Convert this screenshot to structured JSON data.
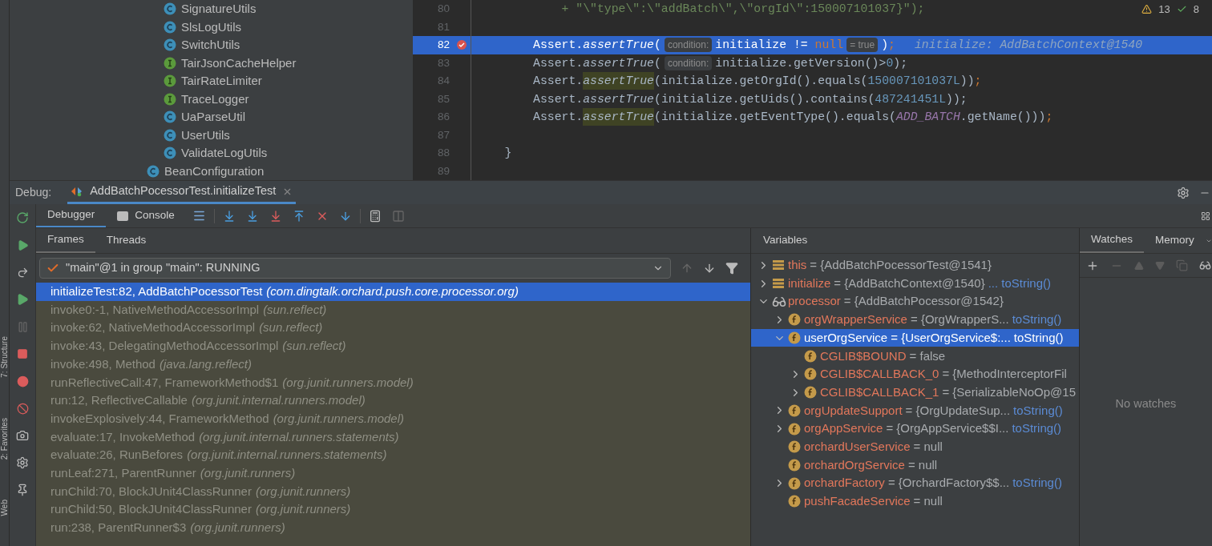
{
  "side_stripe": {
    "labels": [
      "7: Structure",
      "2: Favorites",
      "Web"
    ]
  },
  "project_tree": {
    "nested_items": [
      {
        "label": "SignatureUtils",
        "kind": "class"
      },
      {
        "label": "SlsLogUtils",
        "kind": "class"
      },
      {
        "label": "SwitchUtils",
        "kind": "class"
      },
      {
        "label": "TairJsonCacheHelper",
        "kind": "interface"
      },
      {
        "label": "TairRateLimiter",
        "kind": "interface"
      },
      {
        "label": "TraceLogger",
        "kind": "interface"
      },
      {
        "label": "UaParseUtil",
        "kind": "class"
      },
      {
        "label": "UserUtils",
        "kind": "class"
      },
      {
        "label": "ValidateLogUtils",
        "kind": "class"
      }
    ],
    "items": [
      {
        "label": "BeanConfiguration",
        "kind": "class"
      }
    ]
  },
  "editor": {
    "status": {
      "warnings": "13",
      "checks": "8"
    },
    "lines": [
      {
        "number": "80",
        "selected": false,
        "breakpoint": false,
        "segments": [
          {
            "text": "            + \"\\\"type\\\":\\\"addBatch\\\",\\\"orgId\\\":150007101037}\");",
            "kind": "string"
          }
        ]
      },
      {
        "number": "81",
        "selected": false,
        "breakpoint": false
      },
      {
        "number": "82",
        "selected": true,
        "breakpoint": true,
        "segments": [
          {
            "text": "        Assert.",
            "kind": "plain"
          },
          {
            "text": "assertTrue",
            "kind": "method"
          },
          {
            "text": "(",
            "kind": "plain"
          },
          {
            "text": "condition:",
            "kind": "hint"
          },
          {
            "text": "initialize != ",
            "kind": "plain"
          },
          {
            "text": "null",
            "kind": "keyword"
          },
          {
            "text": "= true",
            "kind": "hint"
          },
          {
            "text": ")",
            "kind": "plain"
          },
          {
            "text": ";",
            "kind": "keyword"
          },
          {
            "text": "initialize: AddBatchContext@1540",
            "kind": "inline_value"
          }
        ]
      },
      {
        "number": "83",
        "selected": false,
        "breakpoint": false,
        "segments": [
          {
            "text": "        Assert.",
            "kind": "plain"
          },
          {
            "text": "assertTrue",
            "kind": "method"
          },
          {
            "text": "(",
            "kind": "plain"
          },
          {
            "text": "condition:",
            "kind": "hint"
          },
          {
            "text": "initialize.getVersion()>",
            "kind": "plain"
          },
          {
            "text": "0",
            "kind": "number"
          },
          {
            "text": ");",
            "kind": "plain"
          }
        ]
      },
      {
        "number": "84",
        "selected": false,
        "breakpoint": false,
        "segments": [
          {
            "text": "        Assert.",
            "kind": "plain"
          },
          {
            "text": "assertTrue",
            "kind": "marked_method"
          },
          {
            "text": "(initialize.getOrgId().equals(",
            "kind": "plain"
          },
          {
            "text": "150007101037L",
            "kind": "number"
          },
          {
            "text": "))",
            "kind": "plain"
          },
          {
            "text": ";",
            "kind": "keyword"
          }
        ]
      },
      {
        "number": "85",
        "selected": false,
        "breakpoint": false,
        "segments": [
          {
            "text": "        Assert.",
            "kind": "plain"
          },
          {
            "text": "assertTrue",
            "kind": "method"
          },
          {
            "text": "(initialize.getUids().contains(",
            "kind": "plain"
          },
          {
            "text": "487241451L",
            "kind": "number"
          },
          {
            "text": "));",
            "kind": "plain"
          }
        ]
      },
      {
        "number": "86",
        "selected": false,
        "breakpoint": false,
        "segments": [
          {
            "text": "        Assert.",
            "kind": "plain"
          },
          {
            "text": "assertTrue",
            "kind": "marked_method"
          },
          {
            "text": "(initialize.getEventType().equals(",
            "kind": "plain"
          },
          {
            "text": "ADD_BATCH",
            "kind": "constant"
          },
          {
            "text": ".getName()))",
            "kind": "plain"
          },
          {
            "text": ";",
            "kind": "keyword"
          }
        ]
      },
      {
        "number": "87",
        "selected": false,
        "breakpoint": false
      },
      {
        "number": "88",
        "selected": false,
        "breakpoint": false,
        "segments": [
          {
            "text": "    }",
            "kind": "plain"
          }
        ]
      },
      {
        "number": "89",
        "selected": false,
        "breakpoint": false
      }
    ]
  },
  "debug": {
    "label": "Debug:",
    "session_tab": "AddBatchPocessorTest.initializeTest",
    "tabs": [
      {
        "label": "Debugger",
        "selected": true
      },
      {
        "label": "Console",
        "selected": false
      }
    ],
    "frames_tabs": [
      {
        "label": "Frames",
        "selected": true
      },
      {
        "label": "Threads",
        "selected": false
      }
    ],
    "thread": "\"main\"@1 in group \"main\": RUNNING",
    "frames": [
      {
        "method": "initializeTest:82, AddBatchPocessorTest",
        "package": "(com.dingtalk.orchard.push.core.processor.org)",
        "selected": true,
        "library": false
      },
      {
        "method": "invoke0:-1, NativeMethodAccessorImpl",
        "package": "(sun.reflect)",
        "selected": false,
        "library": true
      },
      {
        "method": "invoke:62, NativeMethodAccessorImpl",
        "package": "(sun.reflect)",
        "selected": false,
        "library": true
      },
      {
        "method": "invoke:43, DelegatingMethodAccessorImpl",
        "package": "(sun.reflect)",
        "selected": false,
        "library": true
      },
      {
        "method": "invoke:498, Method",
        "package": "(java.lang.reflect)",
        "selected": false,
        "library": true
      },
      {
        "method": "runReflectiveCall:47, FrameworkMethod$1",
        "package": "(org.junit.runners.model)",
        "selected": false,
        "library": true
      },
      {
        "method": "run:12, ReflectiveCallable",
        "package": "(org.junit.internal.runners.model)",
        "selected": false,
        "library": true
      },
      {
        "method": "invokeExplosively:44, FrameworkMethod",
        "package": "(org.junit.runners.model)",
        "selected": false,
        "library": true
      },
      {
        "method": "evaluate:17, InvokeMethod",
        "package": "(org.junit.internal.runners.statements)",
        "selected": false,
        "library": true
      },
      {
        "method": "evaluate:26, RunBefores",
        "package": "(org.junit.internal.runners.statements)",
        "selected": false,
        "library": true
      },
      {
        "method": "runLeaf:271, ParentRunner",
        "package": "(org.junit.runners)",
        "selected": false,
        "library": true
      },
      {
        "method": "runChild:70, BlockJUnit4ClassRunner",
        "package": "(org.junit.runners)",
        "selected": false,
        "library": true
      },
      {
        "method": "runChild:50, BlockJUnit4ClassRunner",
        "package": "(org.junit.runners)",
        "selected": false,
        "library": true
      },
      {
        "method": "run:238, ParentRunner$3",
        "package": "(org.junit.runners)",
        "selected": false,
        "library": true
      }
    ],
    "variables": {
      "title": "Variables",
      "items": [
        {
          "kind": "local",
          "name": "this",
          "value": "= {AddBatchPocessorTest@1541}",
          "expanded": false,
          "selected": false
        },
        {
          "kind": "local",
          "name": "initialize",
          "value": "= {AddBatchContext@1540}",
          "link": "... toString()",
          "expanded": false,
          "selected": false
        },
        {
          "kind": "watch",
          "name": "processor",
          "value": "= {AddBatchPocessor@1542}",
          "expanded": true,
          "selected": false,
          "children": [
            {
              "kind": "field",
              "name": "orgWrapperService",
              "value": "= {OrgWrapperS...",
              "link": "toString()",
              "expanded": false,
              "selected": false
            },
            {
              "kind": "field",
              "name": "userOrgService",
              "value": "= {UserOrgService$:...",
              "link": "toString()",
              "expanded": true,
              "selected": true,
              "children": [
                {
                  "kind": "field",
                  "name": "CGLIB$BOUND",
                  "value": "= false",
                  "selected": false
                },
                {
                  "kind": "field",
                  "name": "CGLIB$CALLBACK_0",
                  "value": "= {MethodInterceptorFil",
                  "expanded": false,
                  "selected": false
                },
                {
                  "kind": "field",
                  "name": "CGLIB$CALLBACK_1",
                  "value": "= {SerializableNoOp@15",
                  "expanded": false,
                  "selected": false
                }
              ]
            },
            {
              "kind": "field",
              "name": "orgUpdateSupport",
              "value": "= {OrgUpdateSup...",
              "link": "toString()",
              "expanded": false,
              "selected": false
            },
            {
              "kind": "field",
              "name": "orgAppService",
              "value": "= {OrgAppService$$I...",
              "link": "toString()",
              "expanded": false,
              "selected": false
            },
            {
              "kind": "field",
              "name": "orchardUserService",
              "value": "= null",
              "selected": false
            },
            {
              "kind": "field",
              "name": "orchardOrgService",
              "value": "= null",
              "selected": false
            },
            {
              "kind": "field",
              "name": "orchardFactory",
              "value": "= {OrchardFactory$$...",
              "link": "toString()",
              "expanded": false,
              "selected": false
            },
            {
              "kind": "field",
              "name": "pushFacadeService",
              "value": "= null",
              "selected": false
            }
          ]
        }
      ]
    },
    "watches": {
      "tabs": [
        {
          "label": "Watches",
          "selected": true
        },
        {
          "label": "Memory",
          "selected": false
        }
      ],
      "empty_text": "No watches"
    }
  }
}
